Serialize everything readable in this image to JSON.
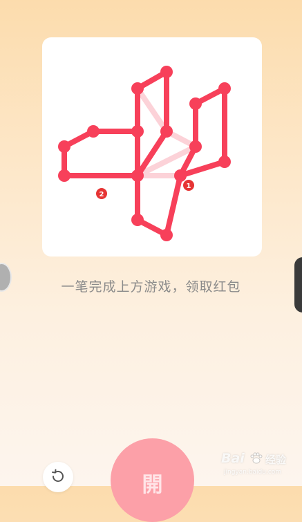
{
  "puzzle": {
    "instruction": "一笔完成上方游戏，领取红包",
    "colors": {
      "traced_line": "#f7405a",
      "untraced_line": "#fcd2d8",
      "marker": "#e63434"
    },
    "markers": [
      {
        "label": "1"
      },
      {
        "label": "2"
      }
    ]
  },
  "controls": {
    "restart_icon": "restart-icon",
    "open_button_label": "開"
  },
  "watermark": {
    "brand": "Bai",
    "brand_suffix": "经验",
    "url": "jingyan.baidu.com"
  }
}
